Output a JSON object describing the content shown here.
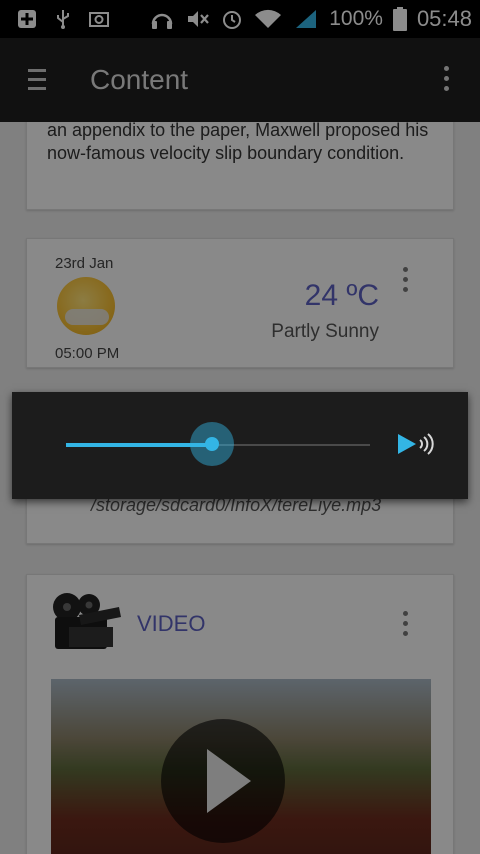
{
  "status_bar": {
    "left_icons": [
      "add-notification-icon",
      "usb-icon",
      "screenshot-icon"
    ],
    "right_icons": [
      "headphones-icon",
      "mute-icon",
      "alarm-icon",
      "wifi-icon",
      "signal-icon",
      "battery-icon"
    ],
    "battery": "100%",
    "time": "05:48"
  },
  "app_bar": {
    "title": "Content",
    "menu_icon": "hamburger-icon",
    "overflow_icon": "overflow-menu-icon"
  },
  "cards": {
    "text": {
      "body": "an appendix to the paper, Maxwell proposed his now-famous velocity slip boundary condition."
    },
    "weather": {
      "date": "23rd Jan",
      "time": "05:00 PM",
      "temperature": "24 ºC",
      "description": "Partly Sunny",
      "icon": "partly-sunny-icon"
    },
    "audio": {
      "path": "/storage/sdcard0/InfoX/tereLiye.mp3"
    },
    "video": {
      "title": "VIDEO",
      "icon": "film-clapper-icon"
    }
  },
  "volume_dialog": {
    "level": 0.48,
    "accent": "#33b5e5",
    "icon": "volume-icon"
  }
}
